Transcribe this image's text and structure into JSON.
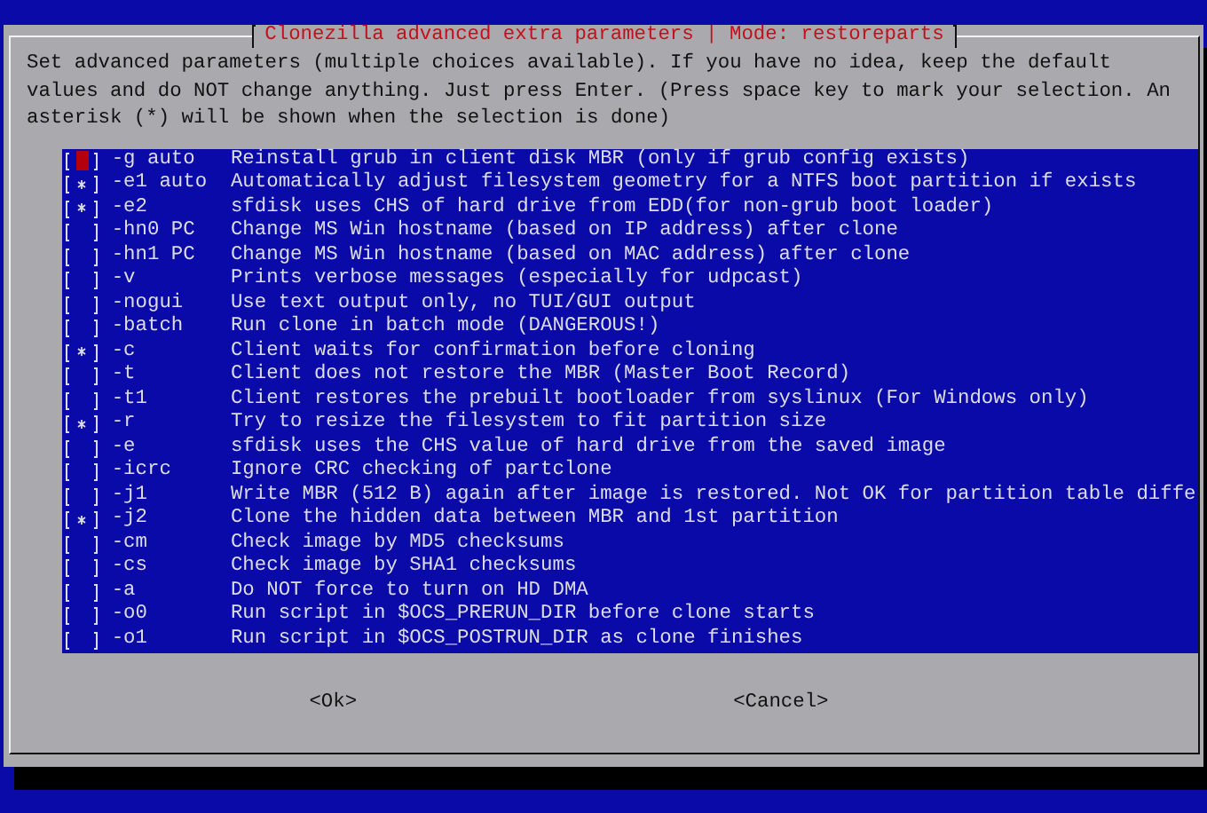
{
  "dialog": {
    "title": "Clonezilla advanced extra parameters | Mode: restoreparts",
    "message": "Set advanced parameters (multiple choices available). If you have no idea, keep the default values and do NOT change anything. Just press Enter. (Press space key to mark your selection. An asterisk (*) will be shown when the selection is done)",
    "items": [
      {
        "option": "-g auto",
        "description": "Reinstall grub in client disk MBR (only if grub config exists)",
        "checked": false,
        "focused": true
      },
      {
        "option": "-e1 auto",
        "description": "Automatically adjust filesystem geometry for a NTFS boot partition if exists",
        "checked": true,
        "focused": false
      },
      {
        "option": "-e2",
        "description": "sfdisk uses CHS of hard drive from EDD(for non-grub boot loader)",
        "checked": true,
        "focused": false
      },
      {
        "option": "-hn0 PC",
        "description": "Change MS Win hostname (based on IP address) after clone",
        "checked": false,
        "focused": false
      },
      {
        "option": "-hn1 PC",
        "description": "Change MS Win hostname (based on MAC address) after clone",
        "checked": false,
        "focused": false
      },
      {
        "option": "-v",
        "description": "Prints verbose messages (especially for udpcast)",
        "checked": false,
        "focused": false
      },
      {
        "option": "-nogui",
        "description": "Use text output only, no TUI/GUI output",
        "checked": false,
        "focused": false
      },
      {
        "option": "-batch",
        "description": "Run clone in batch mode (DANGEROUS!)",
        "checked": false,
        "focused": false
      },
      {
        "option": "-c",
        "description": "Client waits for confirmation before cloning",
        "checked": true,
        "focused": false
      },
      {
        "option": "-t",
        "description": "Client does not restore the MBR (Master Boot Record)",
        "checked": false,
        "focused": false
      },
      {
        "option": "-t1",
        "description": "Client restores the prebuilt bootloader from syslinux (For Windows only)",
        "checked": false,
        "focused": false
      },
      {
        "option": "-r",
        "description": "Try to resize the filesystem to fit partition size",
        "checked": true,
        "focused": false
      },
      {
        "option": "-e",
        "description": "sfdisk uses the CHS value of hard drive from the saved image",
        "checked": false,
        "focused": false
      },
      {
        "option": "-icrc",
        "description": "Ignore CRC checking of partclone",
        "checked": false,
        "focused": false
      },
      {
        "option": "-j1",
        "description": "Write MBR (512 B) again after image is restored. Not OK for partition table diffe",
        "checked": false,
        "focused": false
      },
      {
        "option": "-j2",
        "description": "Clone the hidden data between MBR and 1st partition",
        "checked": true,
        "focused": false
      },
      {
        "option": "-cm",
        "description": "Check image by MD5 checksums",
        "checked": false,
        "focused": false
      },
      {
        "option": "-cs",
        "description": "Check image by SHA1 checksums",
        "checked": false,
        "focused": false
      },
      {
        "option": "-a",
        "description": "Do NOT force to turn on HD DMA",
        "checked": false,
        "focused": false
      },
      {
        "option": "-o0",
        "description": "Run script in $OCS_PRERUN_DIR before clone starts",
        "checked": false,
        "focused": false
      },
      {
        "option": "-o1",
        "description": "Run script in $OCS_POSTRUN_DIR as clone finishes",
        "checked": false,
        "focused": false
      }
    ],
    "buttons": [
      {
        "label": "<Ok>"
      },
      {
        "label": "<Cancel>"
      }
    ]
  }
}
